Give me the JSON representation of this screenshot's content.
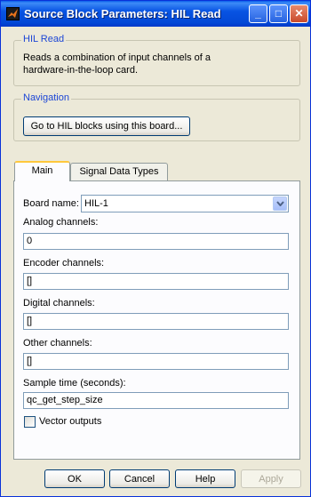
{
  "window": {
    "title": "Source Block Parameters: HIL Read",
    "minimize": "_",
    "maximize": "□",
    "close": "✕"
  },
  "hil_group": {
    "legend": "HIL Read",
    "description_line1": "Reads a combination of input channels of a",
    "description_line2": "hardware-in-the-loop card."
  },
  "navigation": {
    "legend": "Navigation",
    "button_label": "Go to HIL blocks using this board..."
  },
  "tabs": [
    {
      "label": "Main",
      "active": true
    },
    {
      "label": "Signal Data Types",
      "active": false
    }
  ],
  "main": {
    "board_name_label": "Board name:",
    "board_name_value": "HIL-1",
    "analog_label": "Analog channels:",
    "analog_value": "0",
    "encoder_label": "Encoder channels:",
    "encoder_value": "[]",
    "digital_label": "Digital channels:",
    "digital_value": "[]",
    "other_label": "Other channels:",
    "other_value": "[]",
    "sample_time_label": "Sample time (seconds):",
    "sample_time_value": "qc_get_step_size",
    "vector_outputs_label": "Vector outputs",
    "vector_outputs_checked": false
  },
  "footer": {
    "ok": "OK",
    "cancel": "Cancel",
    "help": "Help",
    "apply": "Apply"
  }
}
